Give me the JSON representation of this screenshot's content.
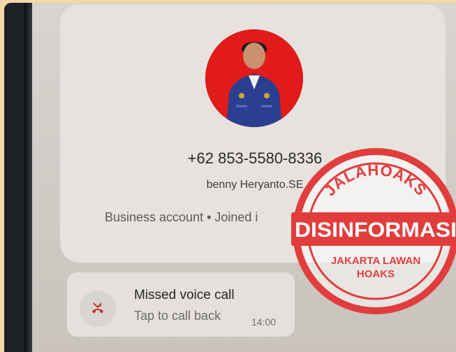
{
  "profile": {
    "phone_number": "+62 853-5580-8336",
    "name": "benny Heryanto.SE",
    "account_info": "Business account • Joined i"
  },
  "call": {
    "title": "Missed voice call",
    "subtitle": "Tap to call back",
    "time": "14:00",
    "icon": "missed-call-icon"
  },
  "stamp": {
    "top_text": "JALAHOAKS",
    "middle_text": "DISINFORMASI",
    "bottom_text_1": "JAKARTA LAWAN",
    "bottom_text_2": "HOAKS",
    "color": "#e23d3d"
  },
  "colors": {
    "background": "#f3d9a8",
    "avatar_bg": "#e11a1a",
    "missed_call_red": "#c0392b"
  }
}
